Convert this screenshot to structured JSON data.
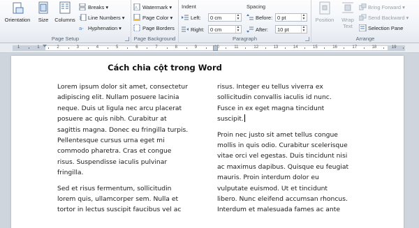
{
  "ribbon": {
    "page_setup": {
      "orientation": "Orientation",
      "size": "Size",
      "columns": "Columns",
      "breaks": "Breaks",
      "line_numbers": "Line Numbers",
      "hyphenation": "Hyphenation",
      "label": "Page Setup"
    },
    "page_background": {
      "watermark": "Watermark",
      "page_color": "Page Color",
      "page_borders": "Page Borders",
      "label": "Page Background"
    },
    "paragraph": {
      "indent_header": "Indent",
      "left_label": "Left:",
      "left_value": "0 cm",
      "right_label": "Right:",
      "right_value": "0 cm",
      "spacing_header": "Spacing",
      "before_label": "Before:",
      "before_value": "0 pt",
      "after_label": "After:",
      "after_value": "10 pt",
      "label": "Paragraph"
    },
    "arrange": {
      "position": "Position",
      "wrap_text_1": "Wrap",
      "wrap_text_2": "Text",
      "bring_forward": "Bring Forward",
      "send_backward": "Send Backward",
      "selection_pane": "Selection Pane",
      "label": "Arrange"
    }
  },
  "ruler": {
    "numbers": [
      "1",
      "1",
      "2",
      "3",
      "4",
      "5",
      "6",
      "7",
      "8",
      "9",
      "10",
      "11",
      "12",
      "13",
      "14",
      "15",
      "16",
      "17",
      "18",
      "19"
    ]
  },
  "document": {
    "title": "Cách chia cột trong Word",
    "col1": {
      "p1": [
        "Lorem ipsum dolor sit amet, consectetur",
        "adipiscing elit. Nullam posuere lacinia",
        "neque. Duis ut ligula nec arcu placerat",
        "posuere ac quis nibh. Curabitur at",
        "sagittis magna. Donec eu fringilla turpis.",
        "Pellentesque cursus urna eget mi",
        "commodo pharetra. Cras et congue",
        "risus. Suspendisse iaculis pulvinar",
        "fringilla."
      ],
      "p2": [
        "Sed et risus fermentum, sollicitudin",
        "lorem quis, ullamcorper sem. Nulla et",
        "tortor in lectus suscipit faucibus vel ac"
      ]
    },
    "col2": {
      "p1": [
        "risus. Integer eu tellus viverra ex",
        "sollicitudin convallis iaculis id nunc.",
        "Fusce in ex eget magna tincidunt",
        "suscipit."
      ],
      "p2": [
        "Proin nec justo sit amet tellus congue",
        "mollis in quis odio. Curabitur scelerisque",
        "vitae orci vel egestas.  Duis tincidunt nisi",
        "ac maximus dapibus. Quisque eu feugiat",
        "mauris. Proin interdum dolor eu",
        "vulputate euismod. Ut et tincidunt",
        "libero. Nunc eleifend accumsan rhoncus.",
        "Interdum et malesuada fames ac ante"
      ]
    }
  }
}
